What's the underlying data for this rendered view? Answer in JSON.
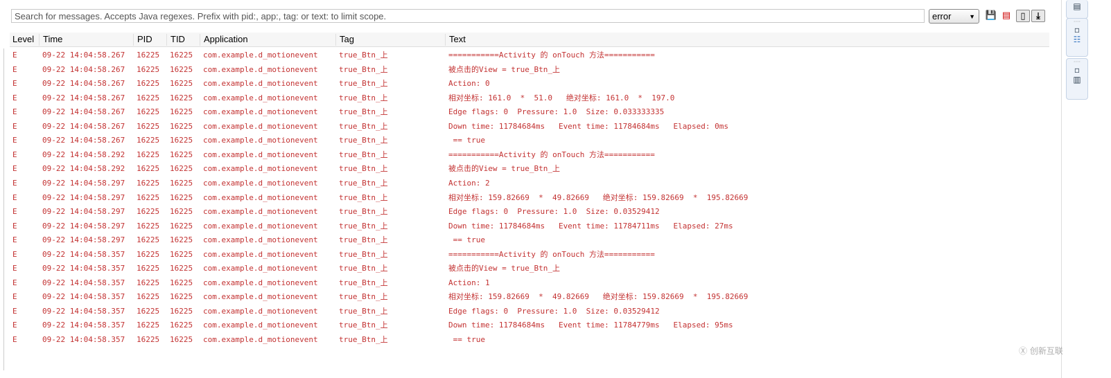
{
  "search": {
    "placeholder": "Search for messages. Accepts Java regexes. Prefix with pid:, app:, tag: or text: to limit scope."
  },
  "level_filter": {
    "selected": "error"
  },
  "toolbar": {
    "icons": [
      "save-icon",
      "clear-log-icon",
      "toggle-panel-icon",
      "scroll-lock-icon"
    ]
  },
  "columns": [
    "Level",
    "Time",
    "PID",
    "TID",
    "Application",
    "Tag",
    "Text"
  ],
  "colors": {
    "error_text": "#c33232"
  },
  "rows": [
    [
      "E",
      "09-22 14:04:58.267",
      "16225",
      "16225",
      "com.example.d_motionevent",
      "true_Btn_上",
      "===========Activity 的 onTouch 方法==========="
    ],
    [
      "E",
      "09-22 14:04:58.267",
      "16225",
      "16225",
      "com.example.d_motionevent",
      "true_Btn_上",
      "被点击的View = true_Btn_上"
    ],
    [
      "E",
      "09-22 14:04:58.267",
      "16225",
      "16225",
      "com.example.d_motionevent",
      "true_Btn_上",
      "Action: 0"
    ],
    [
      "E",
      "09-22 14:04:58.267",
      "16225",
      "16225",
      "com.example.d_motionevent",
      "true_Btn_上",
      "相对坐标: 161.0  *  51.0   绝对坐标: 161.0  *  197.0"
    ],
    [
      "E",
      "09-22 14:04:58.267",
      "16225",
      "16225",
      "com.example.d_motionevent",
      "true_Btn_上",
      "Edge flags: 0  Pressure: 1.0  Size: 0.033333335"
    ],
    [
      "E",
      "09-22 14:04:58.267",
      "16225",
      "16225",
      "com.example.d_motionevent",
      "true_Btn_上",
      "Down time: 11784684ms   Event time: 11784684ms   Elapsed: 0ms"
    ],
    [
      "E",
      "09-22 14:04:58.267",
      "16225",
      "16225",
      "com.example.d_motionevent",
      "true_Btn_上",
      " == true"
    ],
    [
      "E",
      "09-22 14:04:58.292",
      "16225",
      "16225",
      "com.example.d_motionevent",
      "true_Btn_上",
      "===========Activity 的 onTouch 方法==========="
    ],
    [
      "E",
      "09-22 14:04:58.292",
      "16225",
      "16225",
      "com.example.d_motionevent",
      "true_Btn_上",
      "被点击的View = true_Btn_上"
    ],
    [
      "E",
      "09-22 14:04:58.297",
      "16225",
      "16225",
      "com.example.d_motionevent",
      "true_Btn_上",
      "Action: 2"
    ],
    [
      "E",
      "09-22 14:04:58.297",
      "16225",
      "16225",
      "com.example.d_motionevent",
      "true_Btn_上",
      "相对坐标: 159.82669  *  49.82669   绝对坐标: 159.82669  *  195.82669"
    ],
    [
      "E",
      "09-22 14:04:58.297",
      "16225",
      "16225",
      "com.example.d_motionevent",
      "true_Btn_上",
      "Edge flags: 0  Pressure: 1.0  Size: 0.03529412"
    ],
    [
      "E",
      "09-22 14:04:58.297",
      "16225",
      "16225",
      "com.example.d_motionevent",
      "true_Btn_上",
      "Down time: 11784684ms   Event time: 11784711ms   Elapsed: 27ms"
    ],
    [
      "E",
      "09-22 14:04:58.297",
      "16225",
      "16225",
      "com.example.d_motionevent",
      "true_Btn_上",
      " == true"
    ],
    [
      "E",
      "09-22 14:04:58.357",
      "16225",
      "16225",
      "com.example.d_motionevent",
      "true_Btn_上",
      "===========Activity 的 onTouch 方法==========="
    ],
    [
      "E",
      "09-22 14:04:58.357",
      "16225",
      "16225",
      "com.example.d_motionevent",
      "true_Btn_上",
      "被点击的View = true_Btn_上"
    ],
    [
      "E",
      "09-22 14:04:58.357",
      "16225",
      "16225",
      "com.example.d_motionevent",
      "true_Btn_上",
      "Action: 1"
    ],
    [
      "E",
      "09-22 14:04:58.357",
      "16225",
      "16225",
      "com.example.d_motionevent",
      "true_Btn_上",
      "相对坐标: 159.82669  *  49.82669   绝对坐标: 159.82669  *  195.82669"
    ],
    [
      "E",
      "09-22 14:04:58.357",
      "16225",
      "16225",
      "com.example.d_motionevent",
      "true_Btn_上",
      "Edge flags: 0  Pressure: 1.0  Size: 0.03529412"
    ],
    [
      "E",
      "09-22 14:04:58.357",
      "16225",
      "16225",
      "com.example.d_motionevent",
      "true_Btn_上",
      "Down time: 11784684ms   Event time: 11784779ms   Elapsed: 95ms"
    ],
    [
      "E",
      "09-22 14:04:58.357",
      "16225",
      "16225",
      "com.example.d_motionevent",
      "true_Btn_上",
      " == true"
    ]
  ],
  "watermark": {
    "text": "创新互联"
  }
}
